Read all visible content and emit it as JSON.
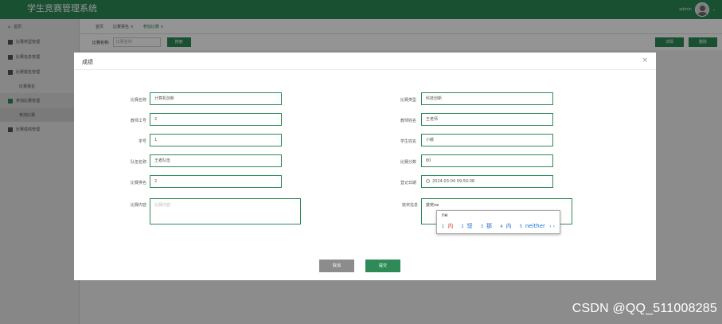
{
  "app": {
    "title": "学生竞赛管理系统",
    "user": "admin"
  },
  "sidebar": {
    "items": [
      {
        "label": "首页"
      },
      {
        "label": "比赛类型管理"
      },
      {
        "label": "比赛信息管理"
      },
      {
        "label": "比赛报名管理"
      },
      {
        "sub": "比赛报名"
      },
      {
        "label": "参加比赛管理"
      },
      {
        "sub": "参加比赛"
      },
      {
        "label": "比赛成绩管理"
      }
    ]
  },
  "tabs": [
    {
      "label": "首页"
    },
    {
      "label": "比赛报名 ×"
    },
    {
      "label": "参加比赛 ×"
    }
  ],
  "toolbar": {
    "search_label": "比赛名称:",
    "search_placeholder": "比赛名称",
    "search_btn": "搜索",
    "detail_btn": "详情",
    "delete_btn": "删除"
  },
  "modal": {
    "title": "成绩",
    "close": "×",
    "fields": {
      "name_label": "比赛名称",
      "name_value": "计算机创新",
      "type_label": "比赛类型",
      "type_value": "科技创新",
      "teacherno_label": "教师工号",
      "teacherno_value": "2",
      "teachername_label": "教师姓名",
      "teachername_value": "王老师",
      "studentno_label": "学号",
      "studentno_value": "1",
      "studentname_label": "学生姓名",
      "studentname_value": "小敏",
      "team_label": "队伍名称",
      "team_value": "王者队伍",
      "score_label": "比赛分数",
      "score_value": "80",
      "rank_label": "比赛排名",
      "rank_value": "2",
      "date_label": "登记日期",
      "date_value": "2024-03-04 09:50:08",
      "content_label": "比赛内容",
      "content_placeholder": "比赛内容",
      "award_label": "获奖信息",
      "award_value": "获奖ne"
    },
    "ime": {
      "composition": "ne",
      "candidates": [
        {
          "n": "1",
          "text": "内"
        },
        {
          "n": "2",
          "text": "馁"
        },
        {
          "n": "3",
          "text": "那"
        },
        {
          "n": "4",
          "text": "内"
        },
        {
          "n": "5",
          "text": "neither"
        }
      ],
      "arrows": "‹ ›"
    },
    "cancel_btn": "取消",
    "submit_btn": "提交"
  },
  "watermark": "CSDN @QQ_511008285"
}
